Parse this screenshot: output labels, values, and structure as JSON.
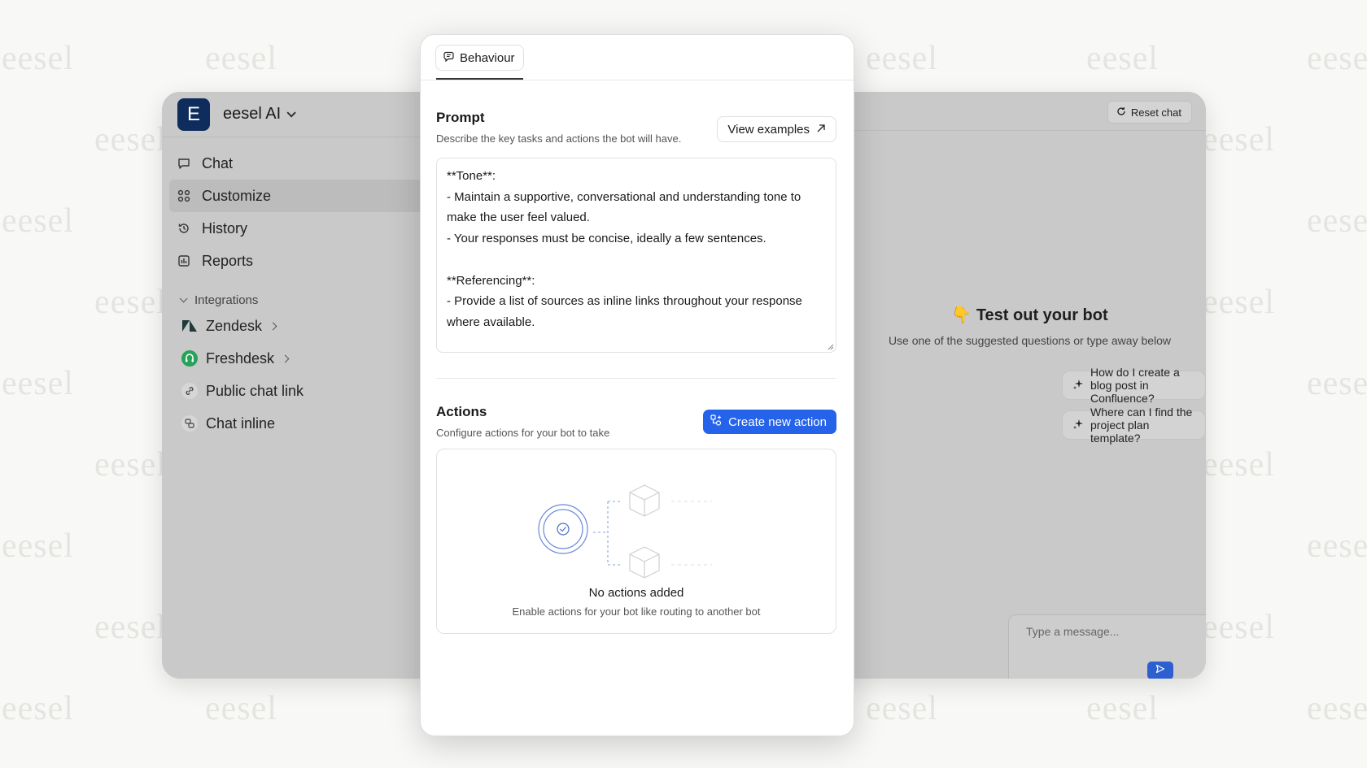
{
  "watermark": {
    "text": "eesel"
  },
  "app": {
    "name": "eesel AI",
    "logo_letter": "E",
    "nav": [
      {
        "label": "Chat",
        "icon": "chat-bubble-icon"
      },
      {
        "label": "Customize",
        "icon": "customize-icon",
        "active": true
      },
      {
        "label": "History",
        "icon": "history-icon"
      },
      {
        "label": "Reports",
        "icon": "reports-icon"
      }
    ],
    "integrations_label": "Integrations",
    "integrations": [
      {
        "label": "Zendesk",
        "icon": "zendesk-icon",
        "has_chevron": true
      },
      {
        "label": "Freshdesk",
        "icon": "freshdesk-icon",
        "has_chevron": true
      },
      {
        "label": "Public chat link",
        "icon": "link-icon"
      },
      {
        "label": "Chat inline",
        "icon": "chat-inline-icon"
      }
    ]
  },
  "chat_preview": {
    "reset_label": "Reset chat",
    "title": "Test out your bot",
    "title_icon": "pointing-hand-icon",
    "subtitle": "Use one of the suggested questions or type away below",
    "suggestions": [
      "How do I create a blog post in Confluence?",
      "Where can I find the project plan template?"
    ],
    "input_placeholder": "Type a message..."
  },
  "panel": {
    "tab_label": "Behaviour",
    "prompt": {
      "title": "Prompt",
      "subtitle": "Describe the key tasks and actions the bot will have.",
      "view_examples_label": "View examples",
      "text": "**Tone**:\n- Maintain a supportive, conversational and understanding tone to make the user feel valued.\n- Your responses must be concise, ideally a few sentences.\n\n**Referencing**:\n- Provide a list of sources as inline links throughout your response where available."
    },
    "actions": {
      "title": "Actions",
      "subtitle": "Configure actions for your bot to take",
      "create_label": "Create new action",
      "empty_title": "No actions added",
      "empty_subtitle": "Enable actions for your bot like routing to another bot"
    }
  },
  "colors": {
    "accent": "#2563eb",
    "logo_bg": "#0f2d5c",
    "app_bg": "#c9c9c9",
    "freshdesk": "#25a35a"
  }
}
